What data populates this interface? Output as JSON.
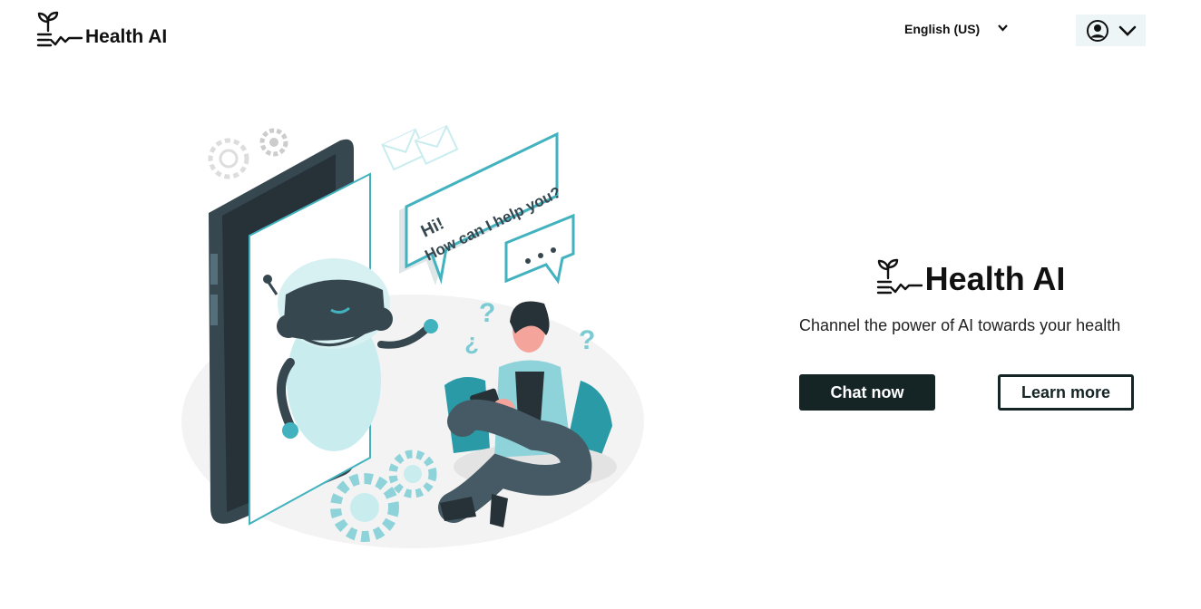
{
  "header": {
    "brand": "Health AI",
    "language": "English (US)",
    "icons": {
      "logo": "sprout-pulse-icon",
      "account": "user-circle-icon",
      "menu": "chevron-down-icon"
    }
  },
  "hero": {
    "brand": "Health AI",
    "tagline": "Channel the power of AI towards your health",
    "primary_button": "Chat now",
    "secondary_button": "Learn more"
  },
  "illustration": {
    "bubble_line1": "Hi!",
    "bubble_line2": "How can I help you?",
    "icons": [
      "robot-icon",
      "phone-icon",
      "person-icon",
      "gear-icon",
      "envelope-icon",
      "question-mark-icon"
    ]
  },
  "colors": {
    "accent": "#43b2bf",
    "accent_light": "#c9ecef",
    "dark": "#152526",
    "user_menu_bg": "#eef5f7"
  }
}
